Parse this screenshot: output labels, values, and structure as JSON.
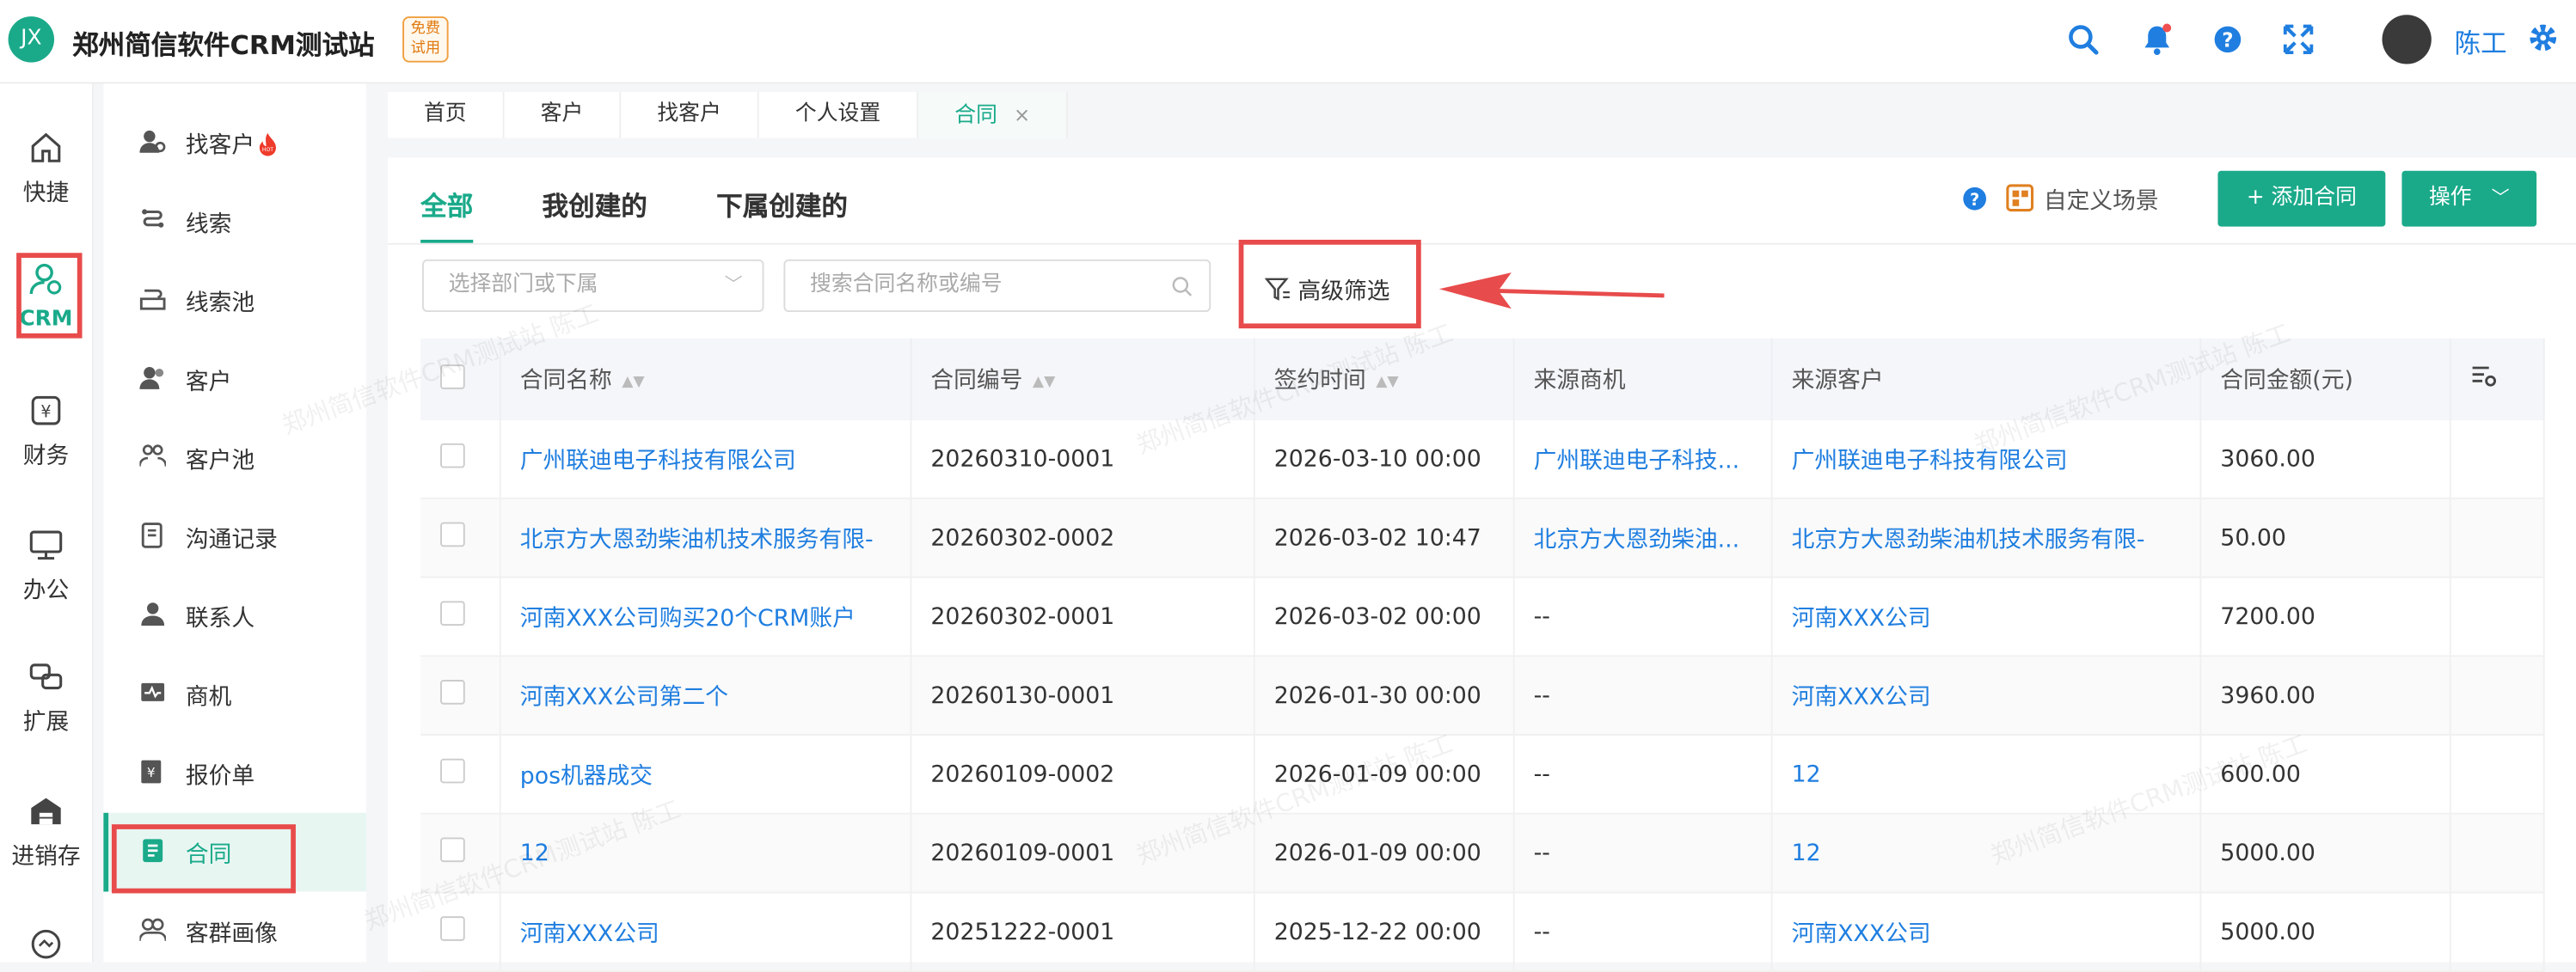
{
  "header": {
    "logo_text": "JX",
    "brand": "郑州简信软件CRM测试站",
    "trial_badge_line1": "免费",
    "trial_badge_line2": "试用",
    "user_name": "陈工",
    "accent": "#1aaa8a",
    "link_color": "#1f7ee0",
    "highlight": "#e84b4b"
  },
  "rail": {
    "items": [
      {
        "label": "快捷",
        "icon": "home-icon"
      },
      {
        "label": "CRM",
        "icon": "crm-user-icon"
      },
      {
        "label": "财务",
        "icon": "finance-icon"
      },
      {
        "label": "办公",
        "icon": "monitor-icon"
      },
      {
        "label": "扩展",
        "icon": "extend-icon"
      },
      {
        "label": "进销存",
        "icon": "warehouse-icon"
      }
    ]
  },
  "submenu": {
    "items": [
      {
        "label": "找客户",
        "icon": "find-customer-icon"
      },
      {
        "label": "线索",
        "icon": "lead-icon"
      },
      {
        "label": "线索池",
        "icon": "lead-pool-icon"
      },
      {
        "label": "客户",
        "icon": "customer-icon"
      },
      {
        "label": "客户池",
        "icon": "customer-pool-icon"
      },
      {
        "label": "沟通记录",
        "icon": "record-icon"
      },
      {
        "label": "联系人",
        "icon": "contact-icon"
      },
      {
        "label": "商机",
        "icon": "opportunity-icon"
      },
      {
        "label": "报价单",
        "icon": "quote-icon"
      },
      {
        "label": "合同",
        "icon": "contract-icon"
      },
      {
        "label": "客群画像",
        "icon": "portrait-icon"
      }
    ],
    "hot_tag": "HOT"
  },
  "tabs": [
    "首页",
    "客户",
    "找客户",
    "个人设置",
    "合同"
  ],
  "subtabs": [
    "全部",
    "我创建的",
    "下属创建的"
  ],
  "toolbar": {
    "custom_scene": "自定义场景",
    "add_contract": "+ 添加合同",
    "operate": "操作"
  },
  "filters": {
    "dept_placeholder": "选择部门或下属",
    "search_placeholder": "搜索合同名称或编号",
    "advanced": "高级筛选"
  },
  "watermark": "郑州简信软件CRM测试站 陈工",
  "table": {
    "columns": [
      "合同名称",
      "合同编号",
      "签约时间",
      "来源商机",
      "来源客户",
      "合同金额(元)"
    ],
    "rows": [
      [
        "广州联迪电子科技有限公司",
        "20260310-0001",
        "2026-03-10 00:00",
        "广州联迪电子科技...",
        "广州联迪电子科技有限公司",
        "3060.00"
      ],
      [
        "北京方大恩劲柴油机技术服务有限-",
        "20260302-0002",
        "2026-03-02 10:47",
        "北京方大恩劲柴油...",
        "北京方大恩劲柴油机技术服务有限-",
        "50.00"
      ],
      [
        "河南XXX公司购买20个CRM账户",
        "20260302-0001",
        "2026-03-02 00:00",
        "--",
        "河南XXX公司",
        "7200.00"
      ],
      [
        "河南XXX公司第二个",
        "20260130-0001",
        "2026-01-30 00:00",
        "--",
        "河南XXX公司",
        "3960.00"
      ],
      [
        "pos机器成交",
        "20260109-0002",
        "2026-01-09 00:00",
        "--",
        "12",
        "600.00"
      ],
      [
        "12",
        "20260109-0001",
        "2026-01-09 00:00",
        "--",
        "12",
        "5000.00"
      ],
      [
        "河南XXX公司",
        "20251222-0001",
        "2025-12-22 00:00",
        "--",
        "河南XXX公司",
        "5000.00"
      ]
    ]
  }
}
